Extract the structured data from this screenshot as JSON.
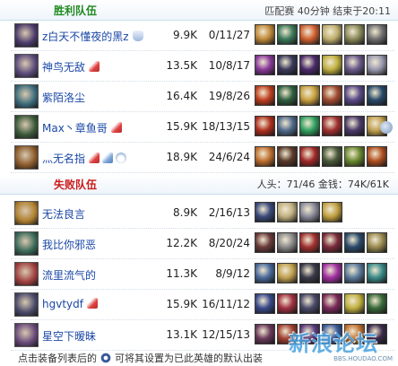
{
  "winning_team": {
    "title": "胜利队伍",
    "match_info": "匹配赛 40分钟 结束于20:11",
    "players": [
      {
        "name": "z白天不懂夜的黑z",
        "damage": "9.9K",
        "kda": "0/11/27",
        "badges": [
          "hand"
        ],
        "avatar_color": "#4a3a6a",
        "items": [
          "#c08a3a",
          "#3c7a5a",
          "#d06030",
          "#c0b070",
          "#8a8a5a",
          "#707070"
        ],
        "extra": false
      },
      {
        "name": "神鸟无敌",
        "damage": "13.5K",
        "kda": "10/8/17",
        "badges": [
          "red"
        ],
        "avatar_color": "#5a4a7a",
        "items": [
          "#8a3a9a",
          "#3a3a5a",
          "#4a2a6a",
          "#c0b040",
          "#6a5a8a",
          "#9a9ab0"
        ],
        "extra": false
      },
      {
        "name": "紫陌洛尘",
        "damage": "16.4K",
        "kda": "19/8/26",
        "badges": [],
        "avatar_color": "#3a6a7a",
        "items": [
          "#c04020",
          "#306040",
          "#c8a040",
          "#a04a30",
          "#5a4a8a",
          "#2a4a6a"
        ],
        "extra": false
      },
      {
        "name": "Max丶章鱼哥",
        "damage": "15.9K",
        "kda": "18/13/15",
        "badges": [
          "red"
        ],
        "avatar_color": "#3a5a3a",
        "items": [
          "#b03020",
          "#506a8a",
          "#30a060",
          "#a03030",
          "#4a3a6a",
          "#c0a050"
        ],
        "extra": true
      },
      {
        "name": "灬无名指",
        "damage": "18.9K",
        "kda": "24/6/24",
        "badges": [
          "red",
          "blue",
          "cloud"
        ],
        "avatar_color": "#8a5a2a",
        "items": [
          "#c07030",
          "#5a3a2a",
          "#a02828",
          "#4a5a3a",
          "#6a8a30",
          "#b05020"
        ],
        "extra": false
      }
    ]
  },
  "losing_team": {
    "title": "失败队伍",
    "stats_text": "人头：71/46 金钱：74K/61K",
    "players": [
      {
        "name": "无法良言",
        "damage": "8.9K",
        "kda": "2/16/13",
        "badges": [],
        "avatar_color": "#b08030",
        "items": [
          "#3a4a7a",
          "#c0b080",
          "#8a8a9a",
          "#c0a040"
        ],
        "extra": false
      },
      {
        "name": "我比你邪恶",
        "damage": "12.2K",
        "kda": "8/20/24",
        "badges": [],
        "avatar_color": "#3a6a5a",
        "items": [
          "#6a3a3a",
          "#8a8a8a",
          "#a03030",
          "#7a2a3a",
          "#2a4a6a",
          "#9a8a50"
        ],
        "extra": false
      },
      {
        "name": "流里流气的",
        "damage": "11.3K",
        "kda": "8/9/12",
        "badges": [],
        "avatar_color": "#a04040",
        "items": [
          "#4a6a9a",
          "#c0a050",
          "#3a3a4a",
          "#a030a0",
          "#5a7a9a",
          "#3a8a8a"
        ],
        "extra": false
      },
      {
        "name": "hgvtydf",
        "damage": "15.9K",
        "kda": "16/11/12",
        "badges": [
          "red"
        ],
        "avatar_color": "#4a4a6a",
        "items": [
          "#3a4a8a",
          "#a03040",
          "#4a4a6a",
          "#7a2a5a",
          "#c0b040",
          "#3a6a3a"
        ],
        "extra": false
      },
      {
        "name": "星空下暧昧",
        "damage": "13.1K",
        "kda": "12/15/13",
        "badges": [],
        "avatar_color": "#6a4a7a",
        "items": [
          "#6a3a5a",
          "#a04030",
          "#5a3a7a",
          "#3a5a9a",
          "#c07030",
          "#3a2a4a"
        ],
        "extra": false
      }
    ]
  },
  "footer": {
    "text_before": "点击装备列表后的",
    "text_after": "可将其设置为已此英雄的默认出装"
  },
  "watermark": {
    "text": "新浪论坛",
    "url": "BBS.HOUDAO.COM"
  }
}
